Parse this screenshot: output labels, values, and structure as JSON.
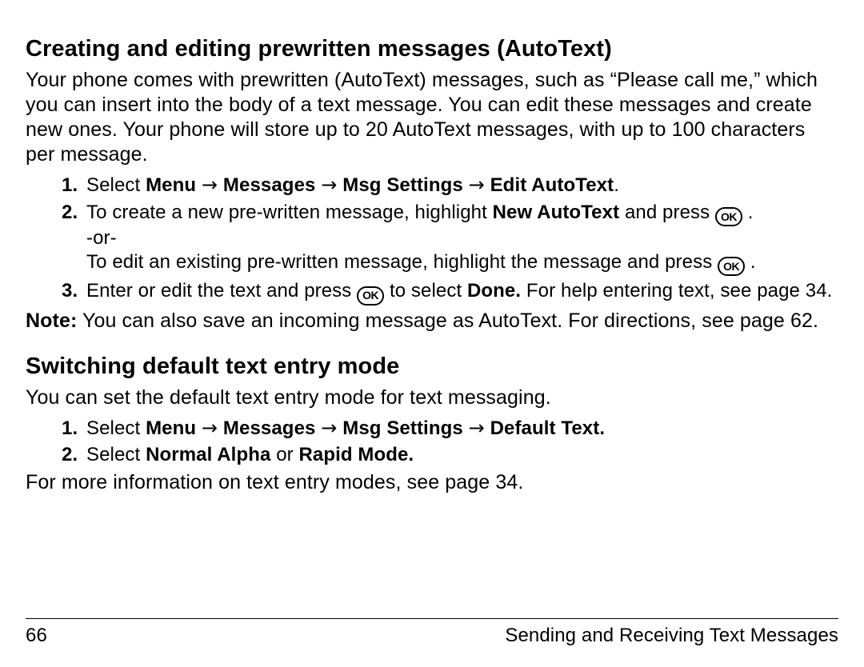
{
  "section1": {
    "heading": "Creating and editing prewritten messages (AutoText)",
    "intro": "Your phone comes with prewritten (AutoText) messages, such as “Please call me,” which you can insert into the body of a text message. You can edit these messages and create new ones. Your phone will store up to 20 AutoText messages, with up to 100 characters per message.",
    "step1": {
      "lead": "Select ",
      "menu": "Menu",
      "messages": "Messages",
      "msg_settings": "Msg Settings",
      "edit_autotext": "Edit AutoText",
      "period": "."
    },
    "step2": {
      "pre": "To create a new pre-written message, highlight ",
      "new_autotext": "New AutoText",
      "post_new": " and press ",
      "period1": " .",
      "or": "-or-",
      "edit_line": "To edit an existing pre-written message, highlight the message and press ",
      "period2": " ."
    },
    "step3": {
      "pre": "Enter or edit the text and press ",
      "mid": " to select ",
      "done": "Done.",
      "post": " For help entering text, see page 34."
    },
    "note_label": "Note:",
    "note_text": " You can also save an incoming message as AutoText. For directions, see page 62."
  },
  "section2": {
    "heading": "Switching default text entry mode",
    "intro": "You can set the default text entry mode for text messaging.",
    "step1": {
      "lead": "Select ",
      "menu": "Menu",
      "messages": "Messages",
      "msg_settings": "Msg Settings",
      "default_text": "Default Text."
    },
    "step2": {
      "lead": "Select ",
      "normal_alpha": "Normal Alpha",
      "or": " or ",
      "rapid_mode": "Rapid Mode."
    },
    "closing": "For more information on text entry modes, see page 34."
  },
  "glyphs": {
    "arrow": "→",
    "ok": "OK"
  },
  "footer": {
    "page": "66",
    "title": "Sending and Receiving Text Messages"
  }
}
